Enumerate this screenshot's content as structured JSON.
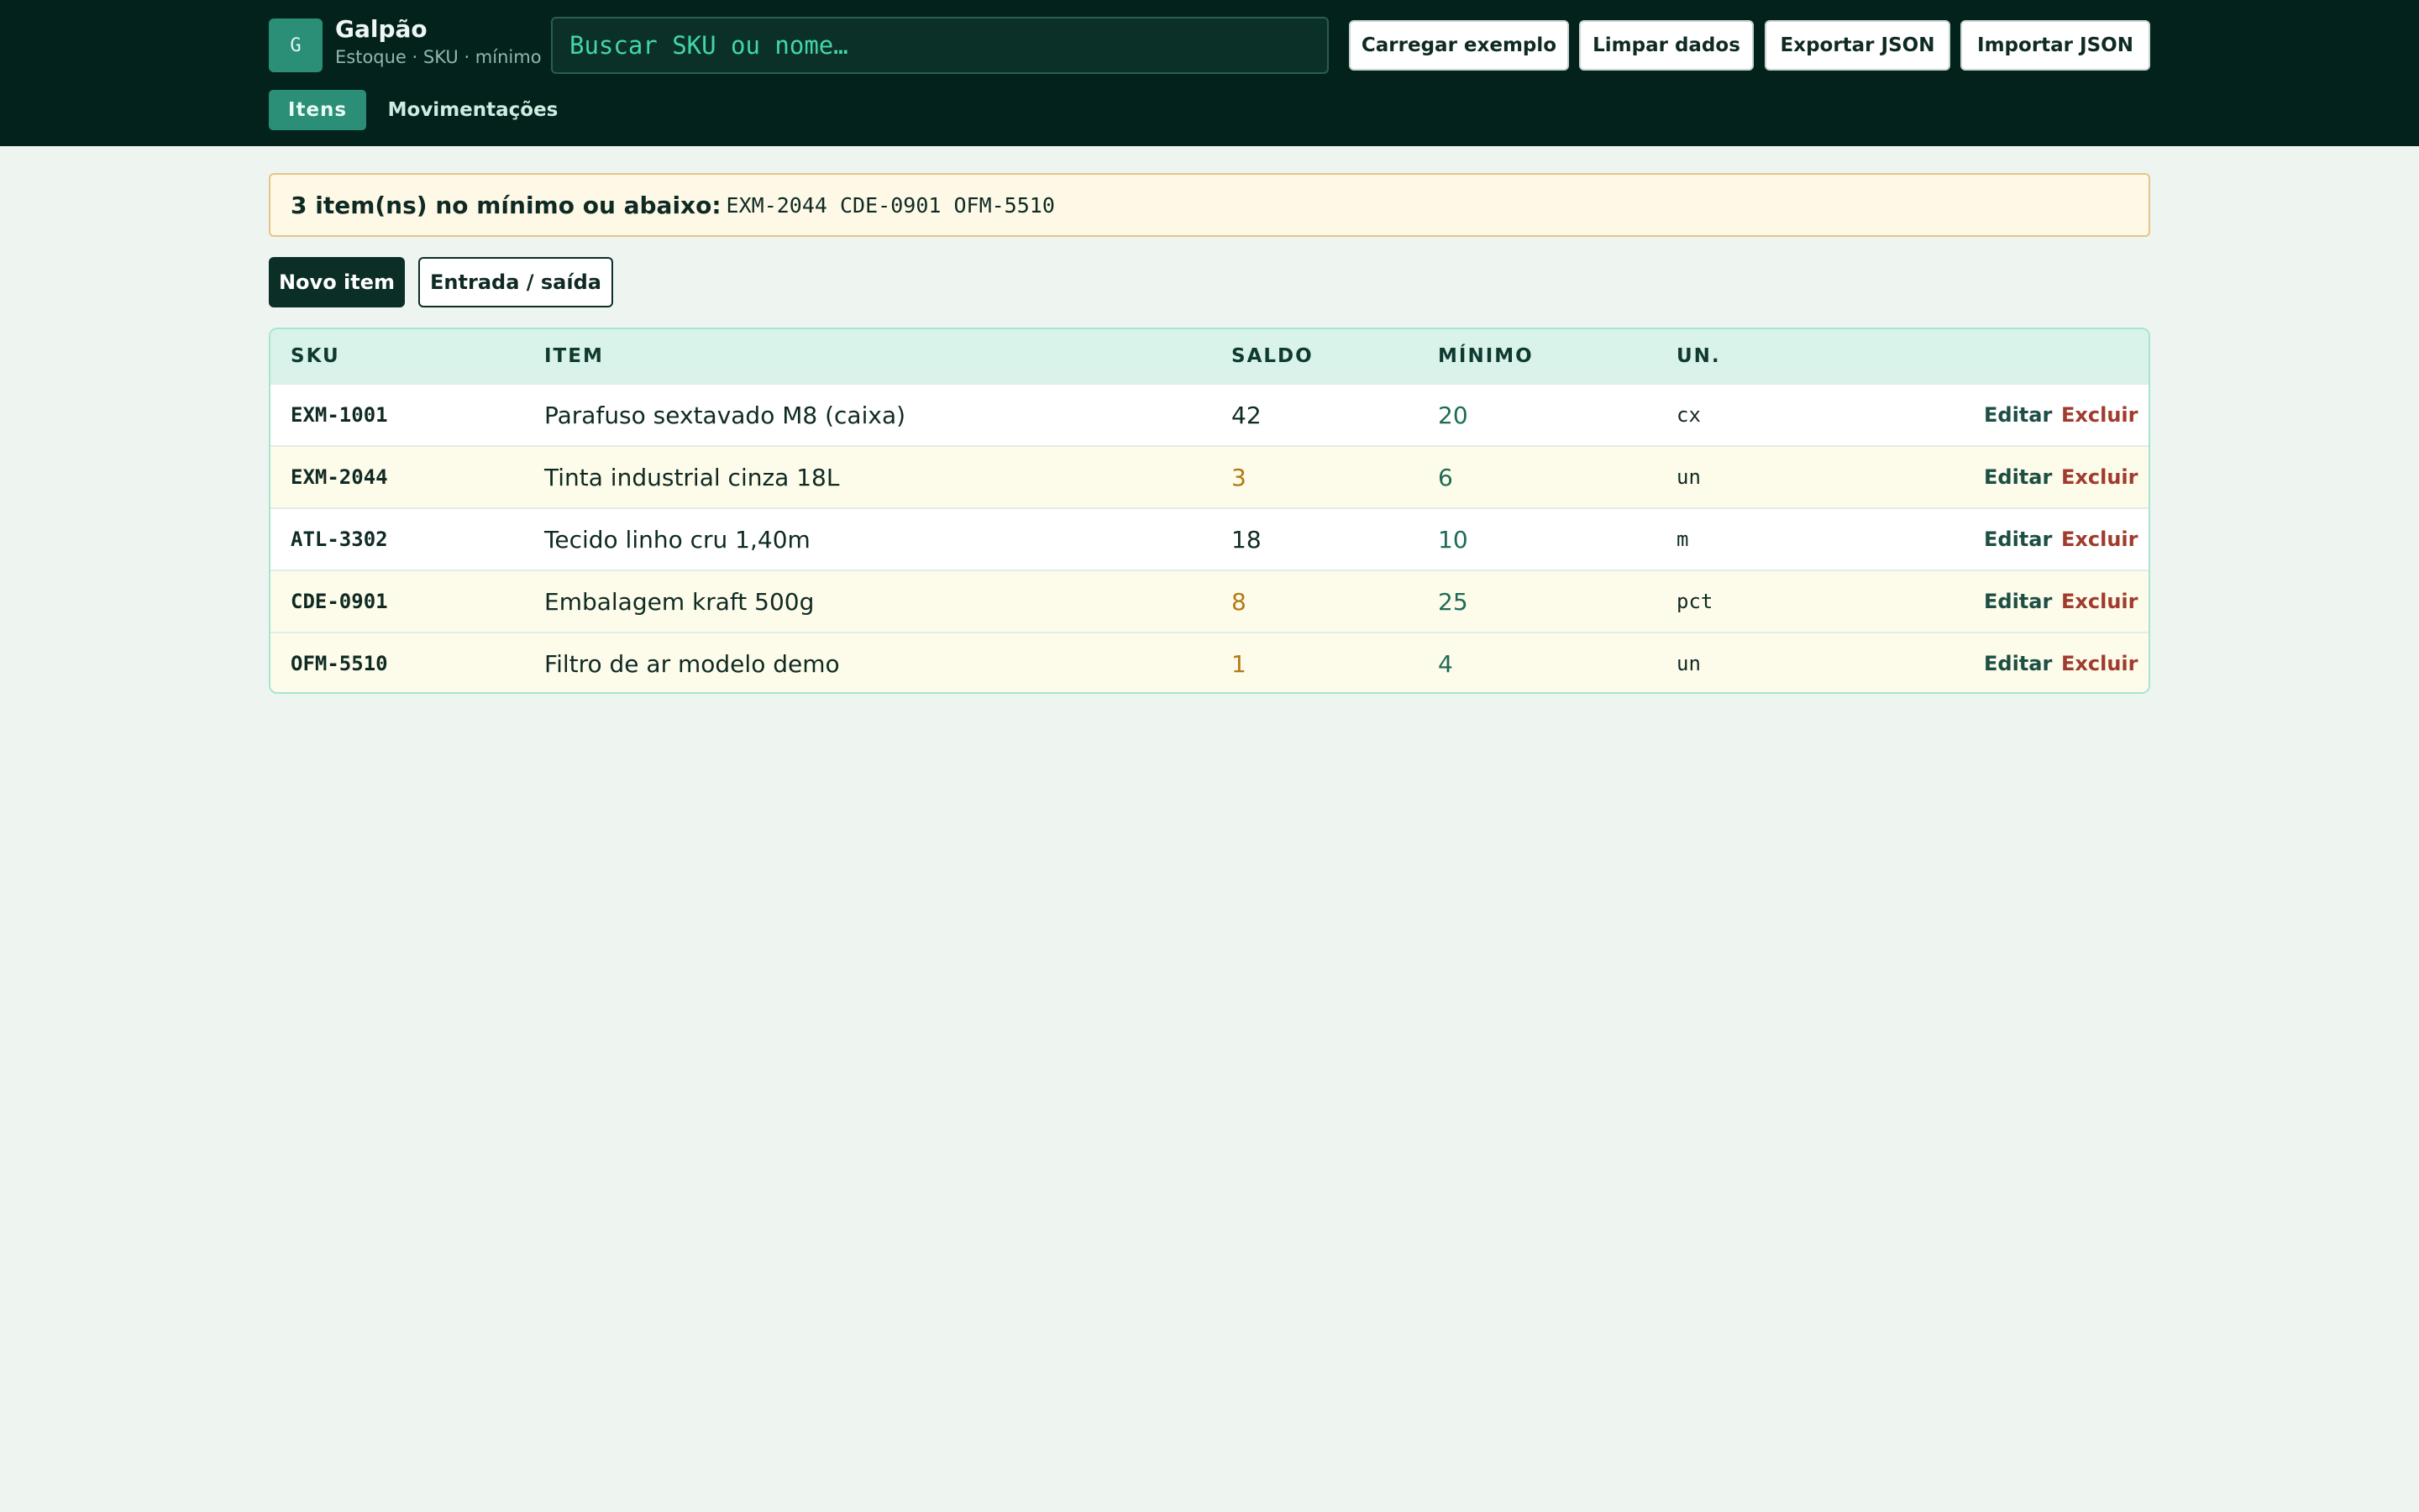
{
  "colors": {
    "header_bg": "#04221c",
    "accent": "#2a8f76",
    "page_bg": "#eef5f1",
    "low_stock": "#b37a12",
    "danger": "#a03c2e",
    "alert_bg": "#fdf9e6"
  },
  "header": {
    "logo_letter": "G",
    "app_name": "Galpão",
    "app_subtitle": "Estoque · SKU · mínimo",
    "search_placeholder": "Buscar SKU ou nome…",
    "buttons": {
      "load_example": "Carregar exemplo",
      "clear_data": "Limpar dados",
      "export_json": "Exportar JSON",
      "import_json": "Importar JSON"
    },
    "tabs": [
      {
        "label": "Itens",
        "active": true
      },
      {
        "label": "Movimentações",
        "active": false
      }
    ]
  },
  "alert": {
    "message": "3 item(ns) no mínimo ou abaixo:",
    "skus": "EXM-2044 CDE-0901 OFM-5510"
  },
  "actions": {
    "new_item": "Novo item",
    "movement": "Entrada / saída"
  },
  "table": {
    "columns": [
      "SKU",
      "ITEM",
      "SALDO",
      "MÍNIMO",
      "UN."
    ],
    "edit_label": "Editar",
    "delete_label": "Excluir",
    "rows": [
      {
        "sku": "EXM-1001",
        "item": "Parafuso sextavado M8 (caixa)",
        "saldo": "42",
        "minimo": "20",
        "un": "cx",
        "low": false
      },
      {
        "sku": "EXM-2044",
        "item": "Tinta industrial cinza 18L",
        "saldo": "3",
        "minimo": "6",
        "un": "un",
        "low": true
      },
      {
        "sku": "ATL-3302",
        "item": "Tecido linho cru 1,40m",
        "saldo": "18",
        "minimo": "10",
        "un": "m",
        "low": false
      },
      {
        "sku": "CDE-0901",
        "item": "Embalagem kraft 500g",
        "saldo": "8",
        "minimo": "25",
        "un": "pct",
        "low": true
      },
      {
        "sku": "OFM-5510",
        "item": "Filtro de ar modelo demo",
        "saldo": "1",
        "minimo": "4",
        "un": "un",
        "low": true
      }
    ]
  }
}
